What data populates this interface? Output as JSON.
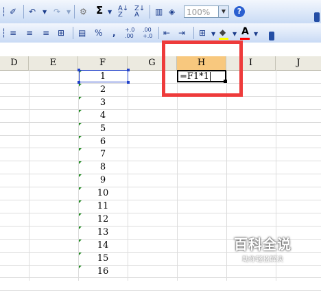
{
  "toolbar": {
    "zoom_value": "100%",
    "sum_symbol": "Σ",
    "percent_label": "%",
    "comma_label": ",",
    "inc_decimal_label": "+.0 .00",
    "dec_decimal_label": ".00 +.0",
    "font_color_label": "A"
  },
  "columns": [
    "D",
    "E",
    "F",
    "G",
    "H",
    "I",
    "J"
  ],
  "active_column": "H",
  "column_f_values": [
    "1",
    "2",
    "3",
    "4",
    "5",
    "6",
    "7",
    "8",
    "9",
    "10",
    "11",
    "12",
    "13",
    "14",
    "15",
    "16"
  ],
  "editing_cell": {
    "address": "H1",
    "formula": "=F1*1"
  },
  "watermark": {
    "title": "百科全说",
    "subtitle": "助你轻松解决"
  },
  "colors": {
    "highlight_box": "#ee3b3b",
    "active_header": "#f8c87e",
    "selection": "#2242c9",
    "number_text_marker": "#1e8a1e"
  }
}
